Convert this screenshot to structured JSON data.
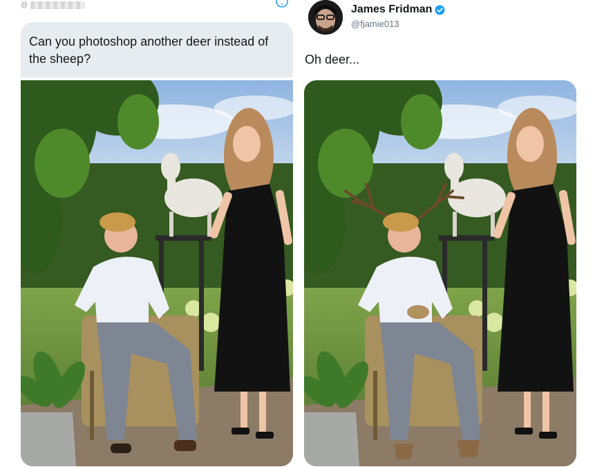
{
  "left_tweet": {
    "handle_prefix": "@",
    "request_text": "Can you photoshop another deer instead of the sheep?",
    "info_icon": "info-circle-icon",
    "photo_alt": "Young man sitting in a wicker chair beside a woman in a black dress, with a white sheep statue behind them in a garden"
  },
  "right_tweet": {
    "display_name": "James Fridman",
    "handle": "@fjamie013",
    "verified_icon": "verified-badge-icon",
    "reply_text": "Oh deer...",
    "photo_alt": "Edited photo: the man has antlers on his head and hooves instead of hands and feet"
  },
  "colors": {
    "bubble": "#e6ecf0",
    "verified": "#1da1f2",
    "secondary_text": "#657786"
  }
}
